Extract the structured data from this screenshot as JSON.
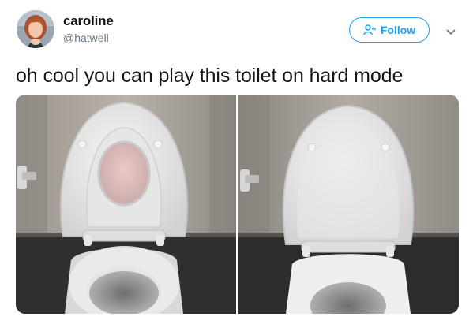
{
  "author": {
    "name": "caroline",
    "handle": "@hatwell"
  },
  "follow_button": {
    "label": "Follow",
    "icon": "add-person-icon"
  },
  "menu_icon": "chevron-down-icon",
  "tweet": {
    "text": "oh cool you can play this toilet on hard mode"
  },
  "media": {
    "photo_count": 2,
    "left_photo": "toilet-seat-child-insert-down",
    "right_photo": "toilet-seat-lid-open"
  },
  "colors": {
    "accent": "#1da1f2",
    "text": "#14171a",
    "secondary_text": "#657786"
  }
}
